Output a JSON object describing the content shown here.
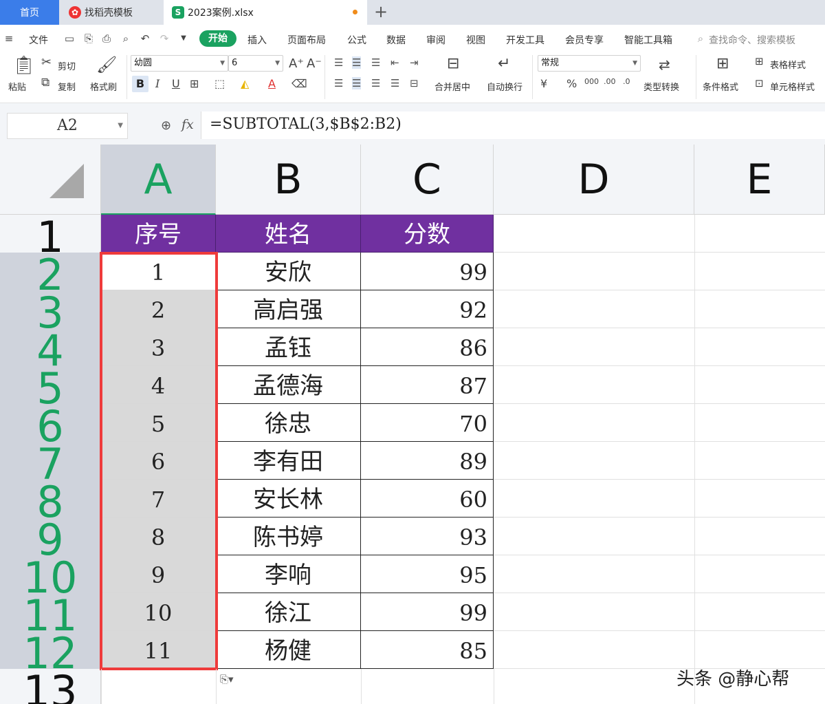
{
  "tabs": {
    "home": "首页",
    "template": "找稻壳模板",
    "file": "2023案例.xlsx",
    "add": "+"
  },
  "menu": {
    "file": "文件",
    "start": "开始",
    "insert": "插入",
    "page_layout": "页面布局",
    "formula": "公式",
    "data": "数据",
    "review": "审阅",
    "view": "视图",
    "dev_tools": "开发工具",
    "member": "会员专享",
    "smart_tools": "智能工具箱",
    "search_placeholder": "查找命令、搜索模板"
  },
  "ribbon": {
    "paste": "粘贴",
    "cut": "剪切",
    "copy": "复制",
    "format_painter": "格式刷",
    "font_name": "幼圆",
    "font_size": "6",
    "merge_center": "合并居中",
    "wrap_text": "自动换行",
    "number_format": "常规",
    "convert_type": "类型转换",
    "conditional_format": "条件格式",
    "table_style": "表格样式",
    "cell_style": "单元格样式"
  },
  "formula_bar": {
    "name_box": "A2",
    "fx": "fx",
    "formula": "=SUBTOTAL(3,$B$2:B2)"
  },
  "sheet": {
    "columns": [
      "A",
      "B",
      "C",
      "D",
      "E"
    ],
    "row_numbers": [
      "1",
      "2",
      "3",
      "4",
      "5",
      "6",
      "7",
      "8",
      "9",
      "10",
      "11",
      "12",
      "13"
    ],
    "headers": [
      "序号",
      "姓名",
      "分数"
    ],
    "rows": [
      {
        "no": "1",
        "name": "安欣",
        "score": "99"
      },
      {
        "no": "2",
        "name": "高启强",
        "score": "92"
      },
      {
        "no": "3",
        "name": "孟钰",
        "score": "86"
      },
      {
        "no": "4",
        "name": "孟德海",
        "score": "87"
      },
      {
        "no": "5",
        "name": "徐忠",
        "score": "70"
      },
      {
        "no": "6",
        "name": "李有田",
        "score": "89"
      },
      {
        "no": "7",
        "name": "安长林",
        "score": "60"
      },
      {
        "no": "8",
        "name": "陈书婷",
        "score": "93"
      },
      {
        "no": "9",
        "name": "李响",
        "score": "95"
      },
      {
        "no": "10",
        "name": "徐江",
        "score": "99"
      },
      {
        "no": "11",
        "name": "杨健",
        "score": "85"
      }
    ]
  },
  "watermark": "头条 @静心帮",
  "colors": {
    "header_fill": "#7030a0",
    "selection_border": "#ef3b3b",
    "accent_green": "#1aa260",
    "selected_fill": "#d9d9d9"
  }
}
